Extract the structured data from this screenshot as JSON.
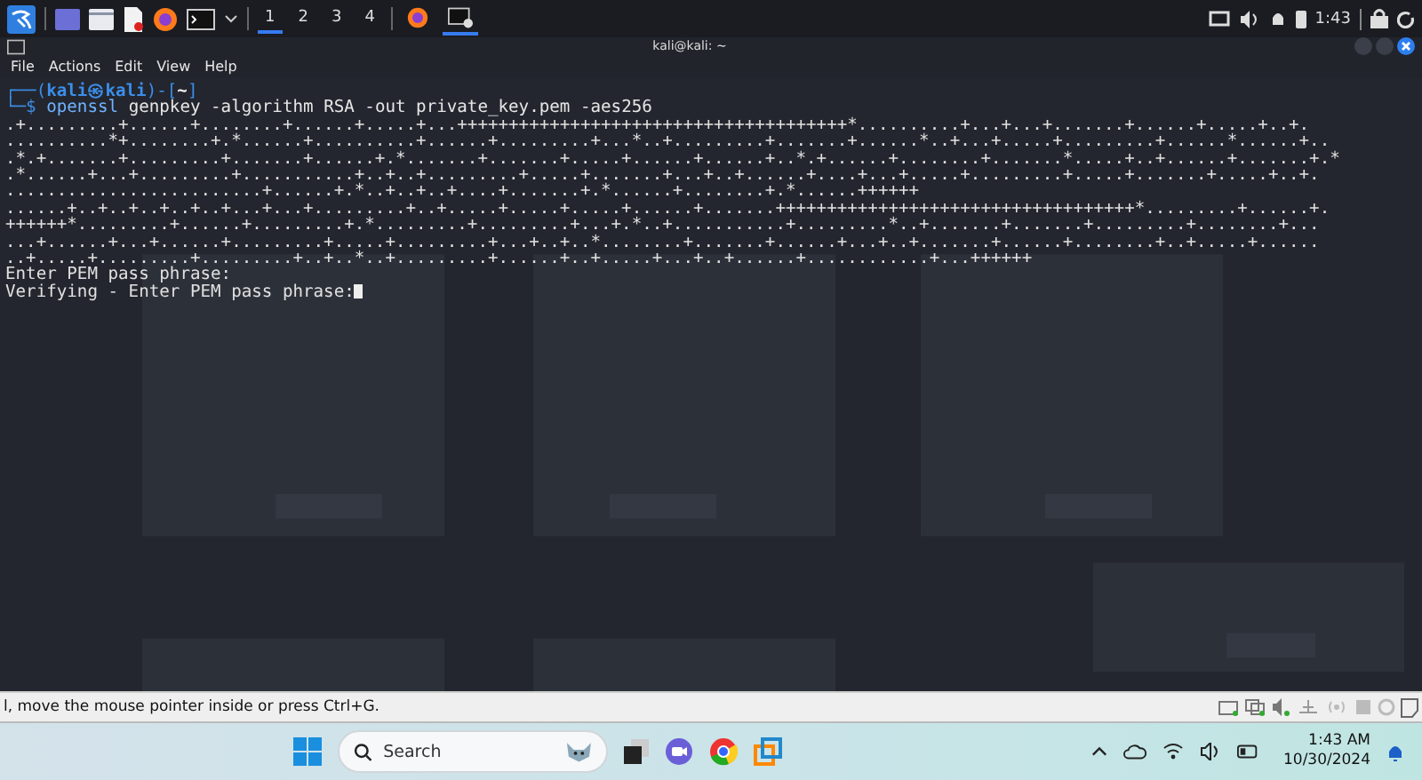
{
  "top_panel": {
    "workspaces": [
      {
        "label": "1",
        "selected": true
      },
      {
        "label": "2",
        "selected": false
      },
      {
        "label": "3",
        "selected": false
      },
      {
        "label": "4",
        "selected": false
      }
    ],
    "tasks": [
      {
        "kind": "browser",
        "selected": false
      },
      {
        "kind": "terminal",
        "selected": true
      }
    ],
    "clock": "1:43"
  },
  "window": {
    "title": "kali@kali: ~",
    "menu": [
      "File",
      "Actions",
      "Edit",
      "View",
      "Help"
    ]
  },
  "terminal": {
    "prompt": [
      {
        "text": "┌──(",
        "kind": "frame"
      },
      {
        "text": "kali㉿kali",
        "kind": "user"
      },
      {
        "text": ")-[",
        "kind": "frame"
      },
      {
        "text": "~",
        "kind": "dir"
      },
      {
        "text": "]",
        "kind": "frame"
      }
    ],
    "command": [
      {
        "text": "└─$ ",
        "kind": "frame"
      },
      {
        "text": "openssl",
        "kind": "cmd"
      },
      {
        "text": " genpkey -algorithm RSA -out private_key.pem -aes256",
        "kind": "arg"
      }
    ],
    "output": [
      ".+.........+......+........+......+.....+...++++++++++++++++++++++++++++++++++++++*..........+...+...+.......+......+.....+..+.",
      "..........*+........+.*......+..........+......+.........+...*..+.........+.......+......*..+...+.....+.........+......*......+..",
      ".*.+.......+.........+.......+......+.*.......+.......+.....+......+......+..*.+......+........+.......*.....+..+......+.......+.*",
      ".*......+...+.........+...........+..+..+.........+.....+.......+...+..+......+....+...+.....+.........+.....+.......+.....+..+.",
      ".........................+......+.*..+..+..+....+.......+.*......+........+.*......++++++",
      "......+..+..+..+..+..+...+...+.........+..+.....+.....+.....+......+.......+++++++++++++++++++++++++++++++++++*.........+......+.",
      "++++++*.........+......+.........+.*.........+.........+...+.*..+...........+.........*..+.......+.......+.........+........+...",
      "...+......+...+......+.........+.....+.........+...+..+..*........+.......+......+...+..+.......+......+........+..+.....+......",
      "..+.....+.........+.........+..+..*..+.........+......+..+.....+...+..+......+............+...++++++"
    ],
    "lines": [
      "Enter PEM pass phrase:",
      "Verifying - Enter PEM pass phrase:"
    ]
  },
  "vm_status": {
    "message": "l, move the mouse pointer inside or press Ctrl+G."
  },
  "taskbar": {
    "search": {
      "placeholder": "Search"
    },
    "time": "1:43 AM",
    "date": "10/30/2024"
  }
}
